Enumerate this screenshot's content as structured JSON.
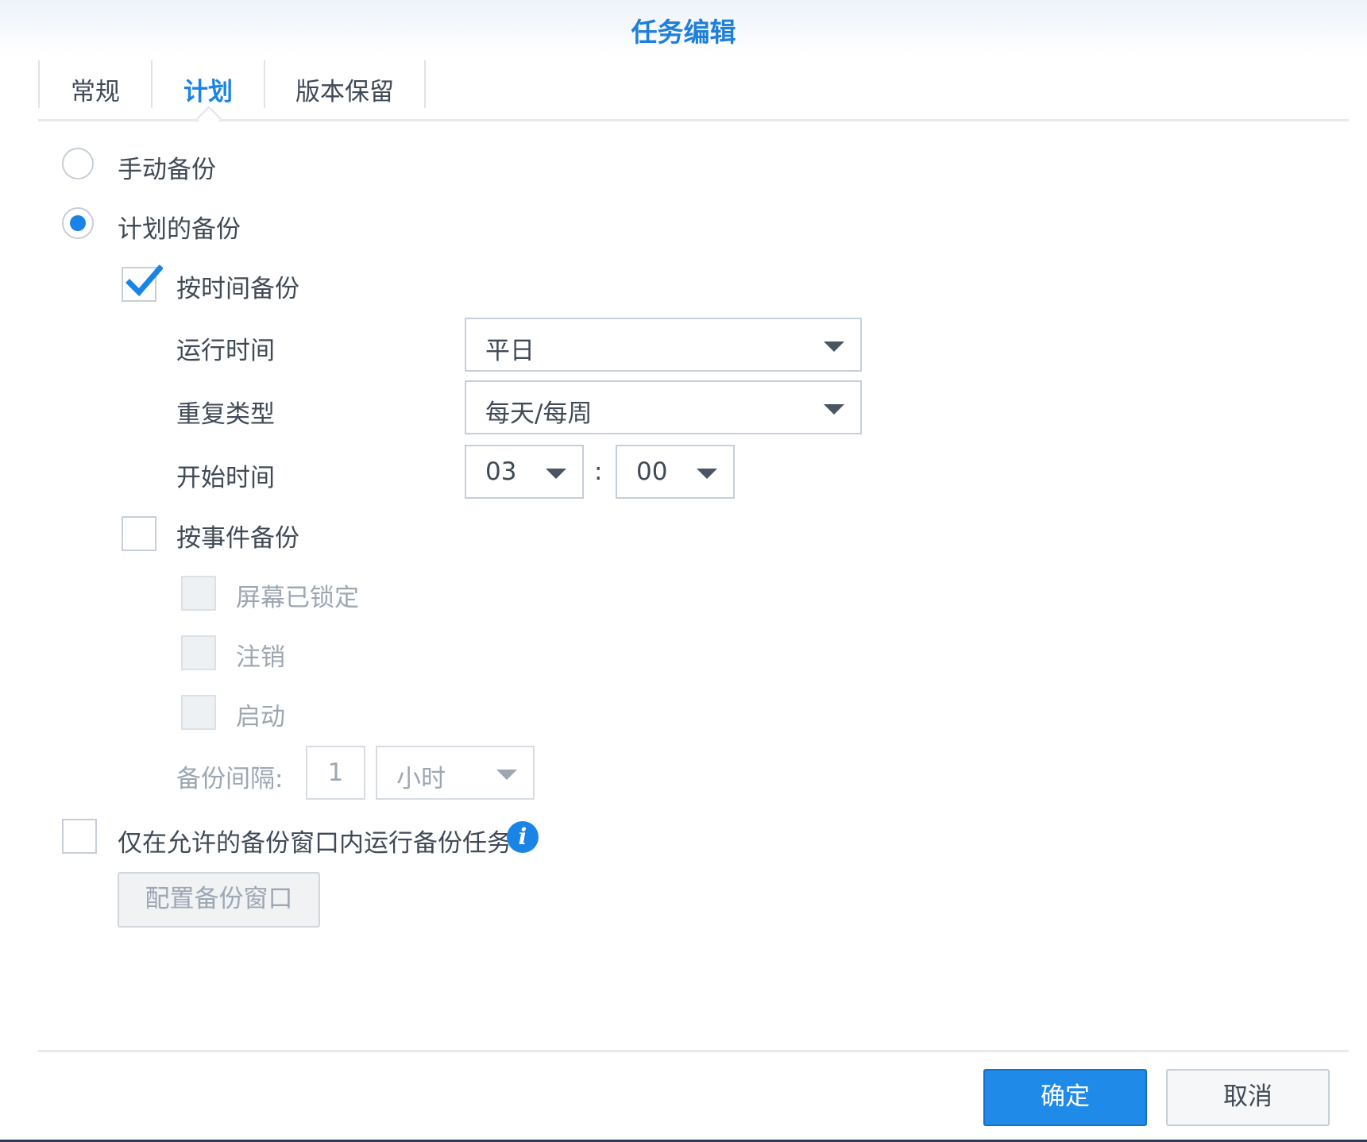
{
  "dialog": {
    "title": "任务编辑"
  },
  "tabs": [
    {
      "label": "常规",
      "active": false
    },
    {
      "label": "计划",
      "active": true
    },
    {
      "label": "版本保留",
      "active": false
    }
  ],
  "schedule": {
    "manual_backup": {
      "label": "手动备份",
      "selected": false
    },
    "scheduled_backup": {
      "label": "计划的备份",
      "selected": true
    },
    "by_time": {
      "label": "按时间备份",
      "checked": true,
      "run_time": {
        "label": "运行时间",
        "value": "平日"
      },
      "repeat_type": {
        "label": "重复类型",
        "value": "每天/每周"
      },
      "start_time": {
        "label": "开始时间",
        "hour": "03",
        "separator": ":",
        "minute": "00"
      }
    },
    "by_event": {
      "label": "按事件备份",
      "checked": false,
      "events": [
        {
          "label": "屏幕已锁定",
          "checked": false,
          "enabled": false
        },
        {
          "label": "注销",
          "checked": false,
          "enabled": false
        },
        {
          "label": "启动",
          "checked": false,
          "enabled": false
        }
      ],
      "interval": {
        "label": "备份间隔:",
        "value": "1",
        "unit": "小时"
      }
    },
    "backup_window": {
      "label": "仅在允许的备份窗口内运行备份任务",
      "checked": false,
      "info_icon": "info-icon",
      "config_button": "配置备份窗口"
    }
  },
  "footer": {
    "ok_label": "确定",
    "cancel_label": "取消"
  },
  "colors": {
    "accent": "#1a84e6",
    "title": "#1f7fd9",
    "text": "#404a56",
    "disabled_text": "#9da7b3"
  }
}
